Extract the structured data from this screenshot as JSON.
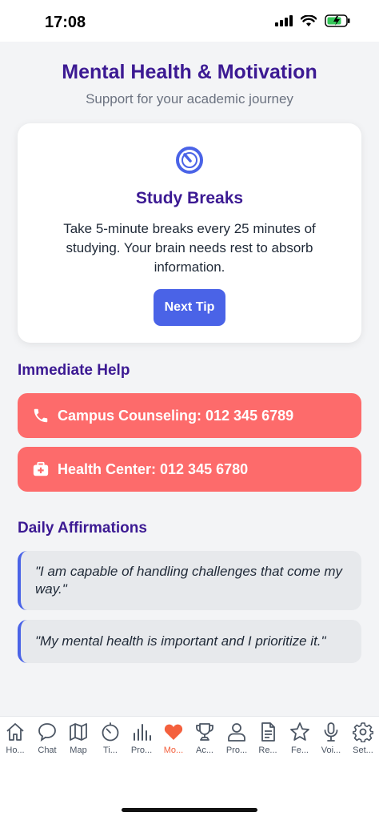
{
  "status_bar": {
    "time": "17:08"
  },
  "header": {
    "title": "Mental Health & Motivation",
    "subtitle": "Support for your academic journey"
  },
  "tip": {
    "icon": "timer-icon",
    "title": "Study Breaks",
    "text": "Take 5-minute breaks every 25 minutes of studying. Your brain needs rest to absorb information.",
    "button_label": "Next Tip"
  },
  "immediate_help": {
    "title": "Immediate Help",
    "items": [
      {
        "icon": "phone-icon",
        "label": "Campus Counseling: 012 345 6789"
      },
      {
        "icon": "medical-kit-icon",
        "label": "Health Center: 012 345 6780"
      }
    ]
  },
  "affirmations": {
    "title": "Daily Affirmations",
    "items": [
      "\"I am capable of handling challenges that come my way.\"",
      "\"My mental health is important and I prioritize it.\""
    ]
  },
  "tabbar": {
    "active_index": 5,
    "active_color": "#f4603d",
    "tabs": [
      {
        "icon": "home-icon",
        "label": "Ho..."
      },
      {
        "icon": "chat-icon",
        "label": "Chat"
      },
      {
        "icon": "map-icon",
        "label": "Map"
      },
      {
        "icon": "timer-icon",
        "label": "Ti..."
      },
      {
        "icon": "bar-chart-icon",
        "label": "Pro..."
      },
      {
        "icon": "heart-icon",
        "label": "Mo..."
      },
      {
        "icon": "trophy-icon",
        "label": "Ac..."
      },
      {
        "icon": "person-icon",
        "label": "Pro..."
      },
      {
        "icon": "document-icon",
        "label": "Re..."
      },
      {
        "icon": "star-icon",
        "label": "Fe..."
      },
      {
        "icon": "microphone-icon",
        "label": "Voi..."
      },
      {
        "icon": "gear-icon",
        "label": "Set..."
      }
    ]
  },
  "colors": {
    "title": "#3c1a93",
    "primary": "#4a63e7",
    "emergency": "#fd6b6b",
    "background": "#f3f4f6"
  }
}
